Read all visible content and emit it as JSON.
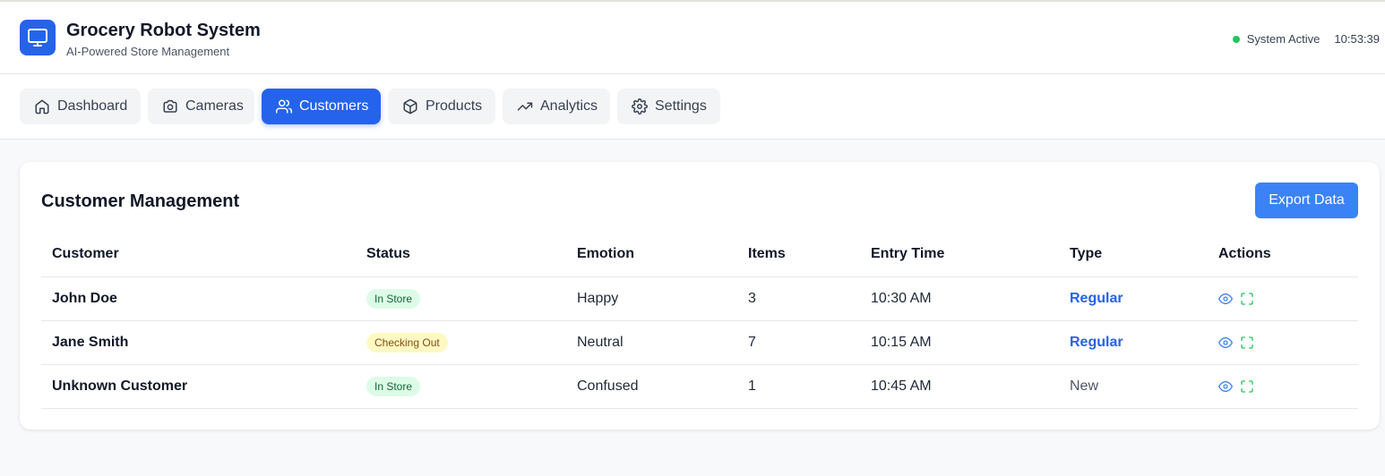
{
  "app": {
    "title": "Grocery Robot System",
    "subtitle": "AI-Powered Store Management",
    "status_text": "System Active",
    "time": "10:53:39"
  },
  "nav": {
    "tabs": [
      {
        "label": "Dashboard",
        "icon": "home-icon",
        "active": false
      },
      {
        "label": "Cameras",
        "icon": "camera-icon",
        "active": false
      },
      {
        "label": "Customers",
        "icon": "users-icon",
        "active": true
      },
      {
        "label": "Products",
        "icon": "package-icon",
        "active": false
      },
      {
        "label": "Analytics",
        "icon": "trending-up-icon",
        "active": false
      },
      {
        "label": "Settings",
        "icon": "gear-icon",
        "active": false
      }
    ]
  },
  "customers": {
    "title": "Customer Management",
    "export_label": "Export Data",
    "columns": [
      "Customer",
      "Status",
      "Emotion",
      "Items",
      "Entry Time",
      "Type",
      "Actions"
    ],
    "rows": [
      {
        "name": "John Doe",
        "status": "In Store",
        "status_color": "green",
        "emotion": "Happy",
        "items": "3",
        "entry_time": "10:30 AM",
        "type": "Regular",
        "type_style": "link"
      },
      {
        "name": "Jane Smith",
        "status": "Checking Out",
        "status_color": "yellow",
        "emotion": "Neutral",
        "items": "7",
        "entry_time": "10:15 AM",
        "type": "Regular",
        "type_style": "link"
      },
      {
        "name": "Unknown Customer",
        "status": "In Store",
        "status_color": "green",
        "emotion": "Confused",
        "items": "1",
        "entry_time": "10:45 AM",
        "type": "New",
        "type_style": "plain"
      }
    ]
  },
  "colors": {
    "primary": "#2563eb",
    "export_button": "#3b82f6",
    "status_active": "#22c55e",
    "view_icon": "#3b82f6",
    "focus_icon": "#22c55e"
  }
}
